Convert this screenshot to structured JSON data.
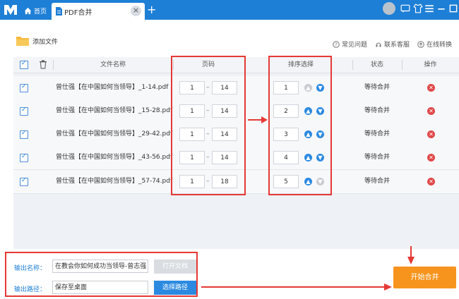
{
  "titlebar": {
    "home_tab": "首页",
    "active_tab": "PDF合并",
    "close_glyph": "×",
    "add_glyph": "+"
  },
  "toolbar": {
    "add_file": "添加文件",
    "faq": "常见问题",
    "support": "联系客服",
    "online": "在线转换"
  },
  "table": {
    "headers": {
      "filename": "文件名称",
      "pages": "页码",
      "order": "排序选择",
      "status": "状态",
      "actions": "操作"
    },
    "rows": [
      {
        "name": "曾仕强【在中国如何当领导】_1-14.pdf",
        "from": "1",
        "to": "14",
        "order": "1",
        "status": "等待合并",
        "up_enabled": false,
        "down_enabled": true
      },
      {
        "name": "曾仕强【在中国如何当领导】_15-28.pdf",
        "from": "1",
        "to": "14",
        "order": "2",
        "status": "等待合并",
        "up_enabled": true,
        "down_enabled": true
      },
      {
        "name": "曾仕强【在中国如何当领导】_29-42.pdf",
        "from": "1",
        "to": "14",
        "order": "3",
        "status": "等待合并",
        "up_enabled": true,
        "down_enabled": true
      },
      {
        "name": "曾仕强【在中国如何当领导】_43-56.pdf",
        "from": "1",
        "to": "14",
        "order": "4",
        "status": "等待合并",
        "up_enabled": true,
        "down_enabled": true
      },
      {
        "name": "曾仕强【在中国如何当领导】_57-74.pdf",
        "from": "1",
        "to": "18",
        "order": "5",
        "status": "等待合并",
        "up_enabled": true,
        "down_enabled": false
      }
    ],
    "dash": "–"
  },
  "output": {
    "name_label": "输出名称：",
    "name_value": "在教会你如何成功当领导-曾志强",
    "open_doc": "打开文档",
    "path_label": "输出路径：",
    "path_value": "保存至桌面",
    "choose_path": "选择路径"
  },
  "start_button": "开始合并",
  "colors": {
    "brand": "#1e7fd6",
    "accent": "#f7941d",
    "highlight": "#e53935",
    "delete": "#e04848"
  }
}
